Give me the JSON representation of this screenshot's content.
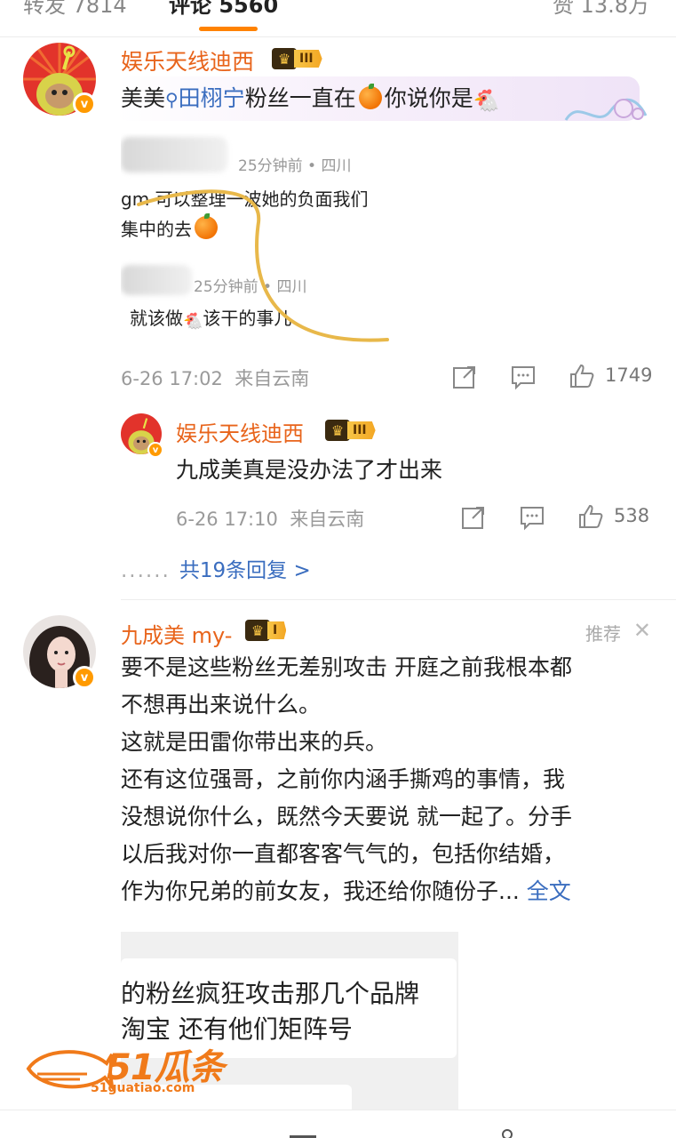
{
  "tabs": {
    "left": "转发 7814",
    "mid": "评论 5560",
    "right": "赞 13.8万"
  },
  "comment1": {
    "username": "娱乐天线迪西",
    "badge_rank": "III",
    "text_before": "美美",
    "topic": "田栩宁",
    "text_middle": "粉丝一直在",
    "text_after": "你说你是",
    "embed": {
      "meta1": "25分钟前 • 四川",
      "line1": "gm 可以整理一波她的负面我们",
      "line2": "集中的去",
      "meta2": "25分钟前 • 四川",
      "line3": "就该做",
      "line3b": "该干的事儿"
    },
    "time": "6-26 17:02",
    "source": "来自云南",
    "likes": "1749"
  },
  "reply1": {
    "username": "娱乐天线迪西",
    "badge_rank": "III",
    "text": "九成美真是没办法了才出来",
    "time": "6-26 17:10",
    "source": "来自云南",
    "likes": "538",
    "more_replies": "共19条回复 >",
    "dots": "......"
  },
  "comment2": {
    "username": "九成美 my-",
    "badge_rank": "I",
    "recommend": "推荐",
    "lines": [
      "要不是这些粉丝无差别攻击 开庭之前我根本都",
      "不想再出来说什么。",
      "这就是田雷你带出来的兵。",
      "还有这位强哥，之前你内涵手撕鸡的事情，我",
      "没想说你什么，既然今天要说 就一起了。分手",
      "以后我对你一直都客客气气的，包括你结婚，",
      "作为你兄弟的前女友，我还给你随份子... "
    ],
    "fulltext": "全文",
    "embed": {
      "line1": "的粉丝疯狂攻击那几个品牌",
      "line2": "淘宝 还有他们矩阵号"
    }
  },
  "watermark": {
    "brand": "51瓜条",
    "url": "51guatiao.com"
  },
  "colors": {
    "username": "#e8641b",
    "link": "#3a6dbf",
    "tab_accent": "#ff8200"
  },
  "icons": [
    "share-icon",
    "comment-icon",
    "like-icon",
    "close-icon",
    "crown-icon"
  ]
}
